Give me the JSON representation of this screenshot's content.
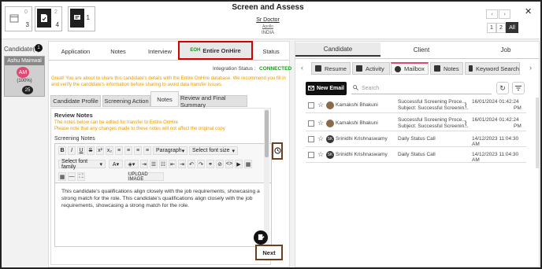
{
  "header": {
    "title": "Screen and Assess",
    "job_title": "Sr Doctor",
    "company": "Apollo",
    "country": "INDIA",
    "counters": [
      {
        "tiny": "0",
        "value": "3"
      },
      {
        "tiny": "2",
        "value": "4"
      },
      {
        "tiny": "",
        "value": "1"
      }
    ],
    "pager": [
      "1",
      "2",
      "All"
    ],
    "close": "✕",
    "prev": "‹",
    "next": "›"
  },
  "candidates": {
    "label": "Candidate(s)",
    "count": "1",
    "card": {
      "name": "Ashu Mainwal",
      "initials": "AM",
      "percent": "(100%)",
      "badge": "25"
    }
  },
  "middle": {
    "tabs": [
      "Application",
      "Notes",
      "Interview",
      "Entire OnHire",
      "Status"
    ],
    "logo_text": "EOH",
    "integration_label": "Integration Status :",
    "integration_value": "CONNECTED",
    "warning": "Great! You are about to share this candidate's details with the Entire OnHire database. We recommend you fill in and verify the candidate's information before sharing to avoid data transfer issues.",
    "subtabs": [
      "Candidate Profile",
      "Screening Action",
      "Notes",
      "Review and Final Summary"
    ],
    "review_title": "Review Notes",
    "review_note1": "The notes below can be edited for transfer to Entire OnHire",
    "review_note2": "Please note that any changes made to these notes will not affect the original copy",
    "screening_label": "Screening Notes",
    "toolbar": {
      "paragraph": "Paragraph",
      "font_size": "Select font size",
      "font_family": "Select font family",
      "upload": "UPLOAD IMAGE"
    },
    "editor_text": "This candidate's qualifications align closely with the job requirements, showcasing a strong match for the role. This candidate's qualifications align closely with the job requirements, showcasing a strong match for the role.",
    "next": "Next"
  },
  "right": {
    "tabs": [
      "Candidate",
      "Client",
      "Job"
    ],
    "subtabs": [
      "Resume",
      "Activity",
      "Mailbox",
      "Notes",
      "Keyword Search"
    ],
    "new_email": "New Email",
    "search_placeholder": "Search",
    "emails": [
      {
        "sender": "Kamakshi Bhakuni",
        "initials": "",
        "subject": "Successful Screening Proce...",
        "subject2": "Subject: Successful Screenin...",
        "date": "16/01/2024 01:42:24",
        "time2": "PM",
        "attach": true
      },
      {
        "sender": "Kamakshi Bhakuni",
        "initials": "",
        "subject": "Successful Screening Proce...",
        "subject2": "Subject: Successful Screenin...",
        "date": "16/01/2024 01:42:24",
        "time2": "PM",
        "attach": true
      },
      {
        "sender": "Srinidhi Krishnaswamy",
        "initials": "SK",
        "subject": "Daily Status Call",
        "subject2": "",
        "date": "14/12/2023 11:04:30 AM",
        "time2": "",
        "attach": false
      },
      {
        "sender": "Srinidhi Krishnaswamy",
        "initials": "SK",
        "subject": "Daily Status Call",
        "subject2": "",
        "date": "14/12/2023 11:04:30 AM",
        "time2": "",
        "attach": false
      }
    ]
  },
  "colors": {
    "accent": "#d40000",
    "brown": "#6b3f1f",
    "connected": "#1a9a1a",
    "warning": "#e69a00",
    "pink": "#e04874"
  }
}
